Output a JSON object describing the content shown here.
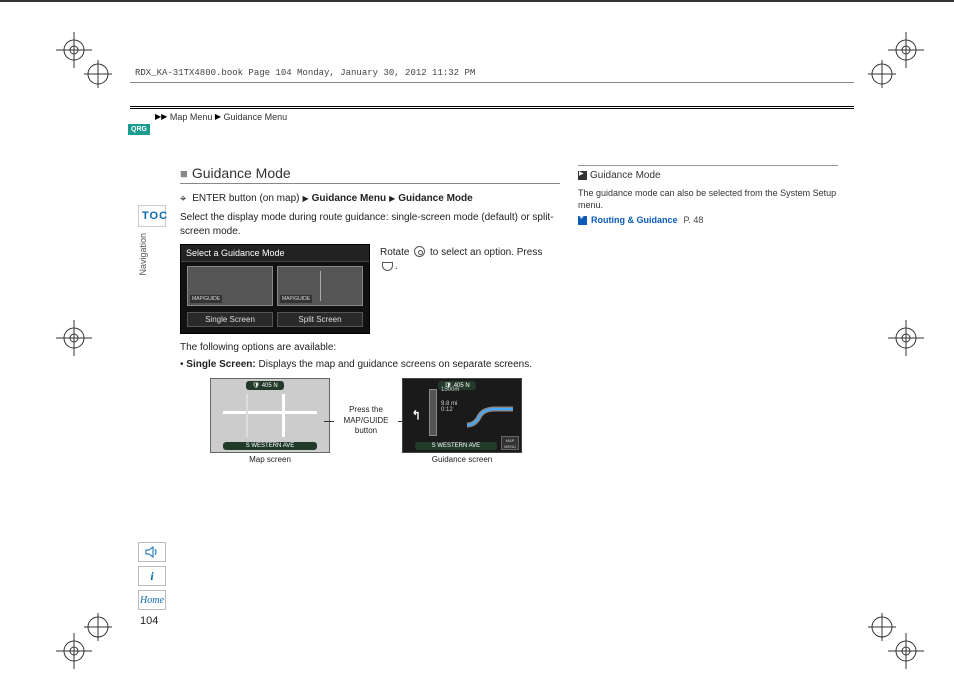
{
  "file_header": "RDX_KA-31TX4800.book  Page 104  Monday, January 30, 2012  11:32 PM",
  "breadcrumb": {
    "a": "Map Menu",
    "b": "Guidance Menu"
  },
  "qrg": "QRG",
  "toc_label": "TOC",
  "nav_label": "Navigation",
  "section_title": "Guidance Mode",
  "path": {
    "enter": "ENTER button (on map)",
    "menu": "Guidance Menu",
    "mode": "Guidance Mode"
  },
  "intro": "Select the display mode during route guidance: single-screen mode (default) or split-screen mode.",
  "mode_screenshot": {
    "title": "Select a Guidance Mode",
    "tagA": "MAP/GUIDE",
    "tagB": "MAP/GUIDE",
    "btnA": "Single Screen",
    "btnB": "Split Screen"
  },
  "rotate_line_a": "Rotate",
  "rotate_line_b": "to select an option. Press",
  "options_label": "The following options are available:",
  "bullet_label": "Single Screen:",
  "bullet_text": " Displays the map and guidance screens on separate screens.",
  "flow": {
    "road_top": "405 N",
    "road_bottom": "S WESTERN AVE",
    "map_caption": "Map screen",
    "mid": "Press the MAP/GUIDE button",
    "guide_caption": "Guidance screen",
    "dist_a": "1500m",
    "dist_b": "9.8 mi",
    "dist_c": "0:12",
    "menu_label": "MAP MENU"
  },
  "sidebar": {
    "hdr": "Guidance Mode",
    "body": "The guidance mode can also be selected from the System Setup menu.",
    "xref": "Routing & Guidance",
    "xref_page": "P. 48"
  },
  "bottom": {
    "home": "Home"
  },
  "page_number": "104"
}
